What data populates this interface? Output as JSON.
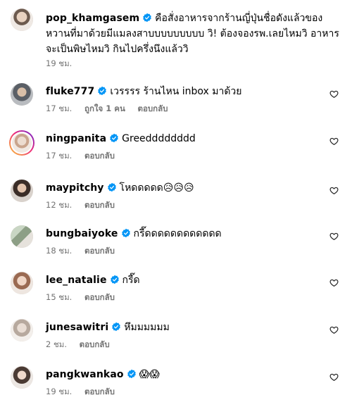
{
  "caption": {
    "username": "pop_khamgasem",
    "text": "คือสั่งอาหารจากร้านญี่ปุ่นชื่อดังแล้วของหวานที่มาด้วยมีแมลงสาบบบบบบบบบ วิ! ต้องจองรพ.เลยไหมวิ อาหารจะเป็นพิษไหมวิ กินไปครึ่งนึงแล้ววิ",
    "time": "19 ชม."
  },
  "comments": [
    {
      "username": "fluke777",
      "text": "เวรรรร ร้านไหน inbox มาด้วย",
      "time": "17 ชม.",
      "likes": "ถูกใจ 1 คน",
      "reply": "ตอบกลับ"
    },
    {
      "username": "ningpanita",
      "text": "Greedddddddd",
      "time": "17 ชม.",
      "reply": "ตอบกลับ"
    },
    {
      "username": "maypitchy",
      "text": "โหดดดดด😥😥😥",
      "time": "12 ชม.",
      "reply": "ตอบกลับ"
    },
    {
      "username": "bungbaiyoke",
      "text": "กรี๊ดดดดดดดดดดดด",
      "time": "18 ชม.",
      "reply": "ตอบกลับ"
    },
    {
      "username": "lee_natalie",
      "text": "กรี๊ด",
      "time": "15 ชม.",
      "reply": "ตอบกลับ"
    },
    {
      "username": "junesawitri",
      "text": "หึมมมมมม",
      "time": "2 ชม.",
      "reply": "ตอบกลับ"
    },
    {
      "username": "pangkwankao",
      "text": "😱😱",
      "time": "19 ชม.",
      "reply": "ตอบกลับ"
    }
  ],
  "icons": {
    "verified": "verified-badge-icon",
    "like": "heart-icon"
  },
  "colors": {
    "verified": "#0095f6",
    "meta": "#737373",
    "story_ring_start": "#f9ce34",
    "story_ring_end": "#6228d7"
  }
}
